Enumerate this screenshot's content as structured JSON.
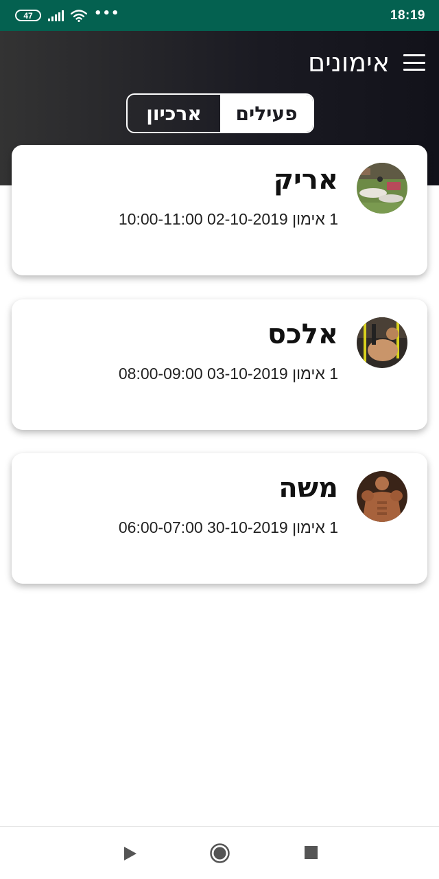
{
  "status_bar": {
    "battery": "47",
    "more": "•••",
    "time": "18:19"
  },
  "header": {
    "title": "אימונים",
    "tabs": [
      {
        "label": "פעילים",
        "active": true
      },
      {
        "label": "ארכיון",
        "active": false
      }
    ]
  },
  "trainings": [
    {
      "name": "אריק",
      "details": "1 אימון 02-10-2019 10:00-11:00"
    },
    {
      "name": "אלכס",
      "details": "1 אימון 03-10-2019 08:00-09:00"
    },
    {
      "name": "משה",
      "details": "1 אימון 30-10-2019 06:00-07:00"
    }
  ],
  "colors": {
    "status_bar": "#046150",
    "header_start": "#333333",
    "header_end": "#12121a"
  },
  "nav_bar": {
    "icons": [
      "back-triangle-icon",
      "home-circle-icon",
      "recents-square-icon"
    ]
  }
}
